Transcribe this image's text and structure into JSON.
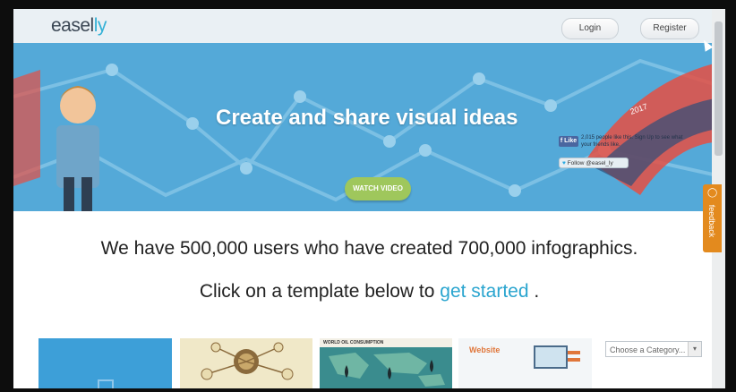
{
  "header": {
    "logo_main": "easel",
    "logo_accent": "ly",
    "login_label": "Login",
    "register_label": "Register"
  },
  "hero": {
    "title": "Create and share visual ideas",
    "watch_button": "WATCH VIDEO",
    "fb_like_label": "Like",
    "fb_text": "2,015 people like this. Sign Up to see what your friends like.",
    "twitter_follow": "Follow @easel_ly",
    "accent_year": "2017"
  },
  "main": {
    "headline": "We have 500,000 users who have created 700,000 infographics.",
    "sub_prefix": "Click on a template below to ",
    "sub_link": "get started",
    "sub_suffix": " .",
    "category_placeholder": "Choose a Category..."
  },
  "templates": [
    {
      "name": "template-blank",
      "label": ""
    },
    {
      "name": "template-mindmap",
      "label": ""
    },
    {
      "name": "template-world-oil",
      "label": "WORLD OIL CONSUMPTION"
    },
    {
      "name": "template-website",
      "label": "Website"
    }
  ],
  "feedback_label": "feedback",
  "colors": {
    "hero_bg": "#54a9d8",
    "accent": "#34b1d6",
    "watch_button": "#9fc75c",
    "feedback": "#e38a1e",
    "link": "#2aa5cf"
  },
  "icons": {
    "facebook": "facebook-icon",
    "twitter": "twitter-bird-icon",
    "feedback": "feedback-bubble-icon",
    "dropdown": "chevron-down-icon"
  }
}
